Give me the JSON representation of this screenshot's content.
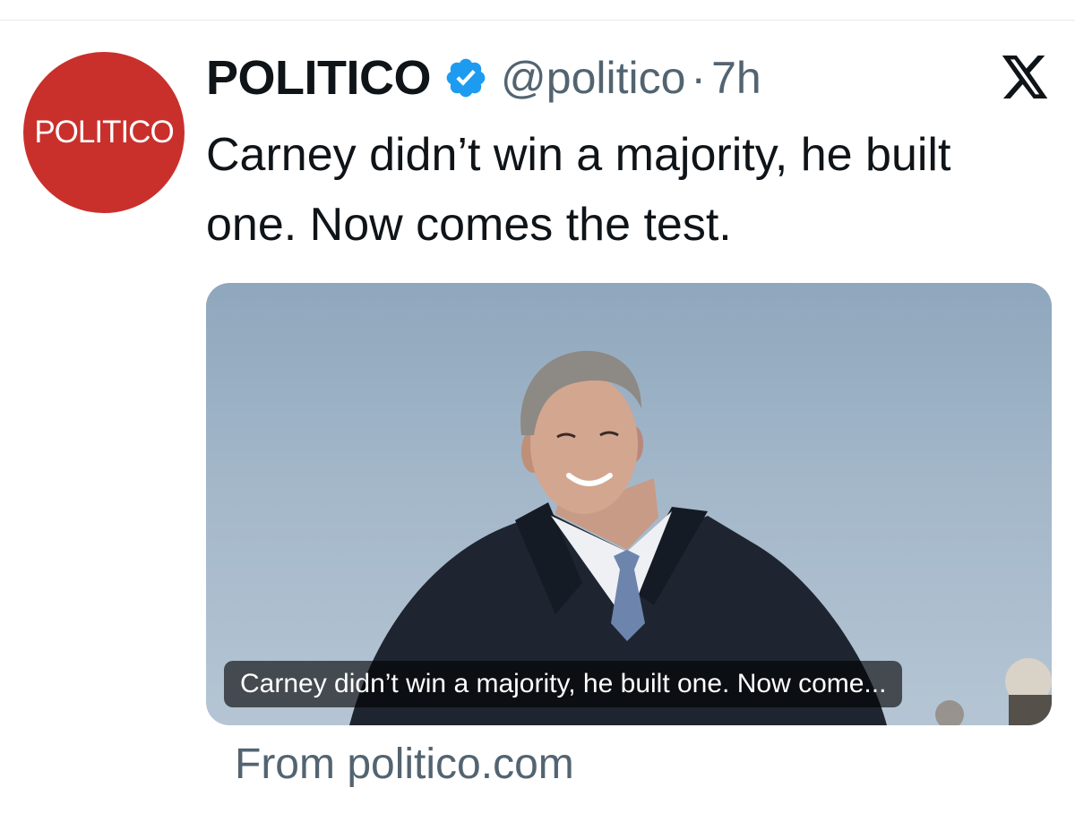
{
  "author": {
    "avatar_text": "POLITICO",
    "display_name": "POLITICO",
    "handle": "@politico",
    "separator": "·",
    "time": "7h",
    "verified_icon": "verified-badge-icon"
  },
  "tweet": {
    "text": "Carney didn’t win a majority, he built one. Now comes the test."
  },
  "card": {
    "caption": "Carney didn’t win a majority, he built one. Now come...",
    "source": "From politico.com"
  },
  "colors": {
    "brand_red": "#c9302c",
    "verified_blue": "#1d9bf0",
    "text_primary": "#0f1419",
    "text_secondary": "#536471"
  },
  "icons": {
    "platform": "x-logo-icon"
  }
}
